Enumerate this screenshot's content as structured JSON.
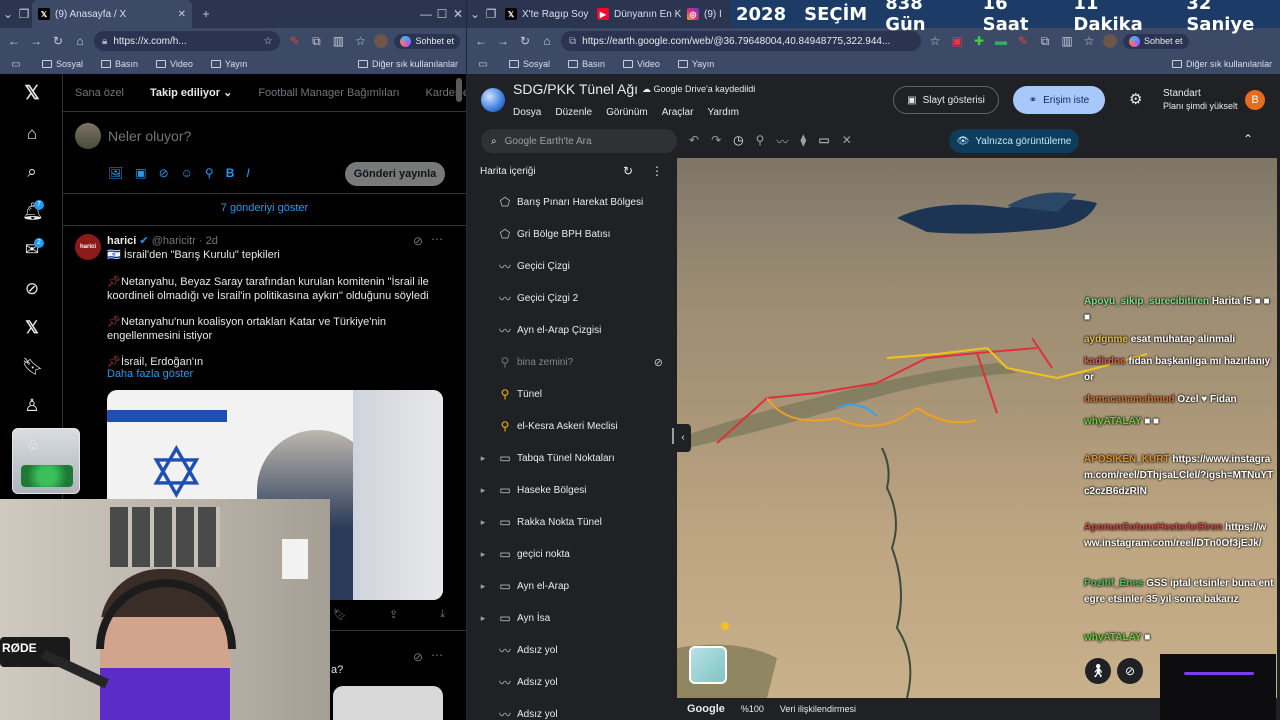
{
  "banner": {
    "year": "2028",
    "label": "SEÇİM",
    "days": "838 Gün",
    "hours": "16 Saat",
    "minutes": "11 Dakika",
    "seconds": "32 Saniye"
  },
  "left_browser": {
    "tab_title": "(9) Anasayfa / X",
    "url": "https://x.com/h...",
    "copilot_label": "Sohbet et",
    "bookmarks": [
      "Sosyal",
      "Basın",
      "Video",
      "Yayın"
    ],
    "other_bookmarks": "Diğer sık kullanılanlar"
  },
  "x": {
    "tabs": {
      "for_you": "Sana özel",
      "following": "Takip ediliyor",
      "fm": "Football Manager Bağımlıları",
      "kardesler": "Kardeşler Kr"
    },
    "composer_placeholder": "Neler oluyor?",
    "post_button": "Gönderi yayınla",
    "show_posts": "7 gönderiyi göster",
    "badges": {
      "notifications": "7",
      "messages": "2"
    },
    "post": {
      "author": "harici",
      "handle": "@haricitr · 2d",
      "avatar_text": "harici",
      "line1": "İsrail'den \"Barış Kurulu\" tepkileri",
      "p1": "Netanyahu, Beyaz Saray tarafından kurulan komitenin \"İsrail ile koordineli olmadığı ve İsrail'in politikasına aykırı\" olduğunu söyledi",
      "p2": "Netanyahu'nun koalisyon ortakları Katar ve Türkiye'nin engellenmesini istiyor",
      "p3": "İsrail, Erdoğan'ın",
      "show_more": "Daha fazla göster"
    },
    "next_post_snippet": "a?"
  },
  "right_browser": {
    "tabs": [
      "X'te Ragıp Soy",
      "Dünyanın En K",
      "(9) I"
    ],
    "url": "https://earth.google.com/web/@36.79648004,40.84948775,322.944...",
    "copilot_label": "Sohbet et",
    "bookmarks": [
      "Sosyal",
      "Basın",
      "Video",
      "Yayın"
    ],
    "other_bookmarks": "Diğer sık kullanılanlar"
  },
  "earth": {
    "project_title": "SDG/PKK Tünel Ağı",
    "saved_status": "Google Drive'a kaydedildi",
    "menu": [
      "Dosya",
      "Düzenle",
      "Görünüm",
      "Araçlar",
      "Yardım"
    ],
    "slideshow": "Slayt gösterisi",
    "request_access": "Erişim iste",
    "plan_name": "Standart",
    "plan_upgrade": "Planı şimdi yükselt",
    "avatar_letter": "B",
    "search_placeholder": "Google Earth'te Ara",
    "view_only": "Yalnızca görüntüleme",
    "panel_title": "Harita içeriği",
    "items": [
      {
        "label": "Barış Pınarı Harekat Bölgesi",
        "icon": "polygon-icon",
        "glyph": "⬠",
        "folder": false
      },
      {
        "label": "Gri Bölge BPH Batısı",
        "icon": "polygon-icon",
        "glyph": "⬠",
        "folder": false
      },
      {
        "label": "Geçici Çizgi",
        "icon": "path-icon",
        "glyph": "〰",
        "folder": false
      },
      {
        "label": "Geçici Çizgi 2",
        "icon": "path-icon",
        "glyph": "〰",
        "folder": false
      },
      {
        "label": "Ayn el-Arap Çizgisi",
        "icon": "path-icon",
        "glyph": "〰",
        "folder": false
      },
      {
        "label": "bina zemini?",
        "icon": "pin-icon",
        "glyph": "⚲",
        "folder": false,
        "dim": true
      },
      {
        "label": "Tünel",
        "icon": "pin-icon",
        "glyph": "⚲",
        "folder": false,
        "orange": true
      },
      {
        "label": "el-Kesra Askeri Meclisi",
        "icon": "pin-icon",
        "glyph": "⚲",
        "folder": false,
        "orange": true
      },
      {
        "label": "Tabqa Tünel Noktaları",
        "icon": "folder-icon",
        "glyph": "▭",
        "folder": true
      },
      {
        "label": "Haseke Bölgesi",
        "icon": "folder-icon",
        "glyph": "▭",
        "folder": true
      },
      {
        "label": "Rakka Nokta Tünel",
        "icon": "folder-icon",
        "glyph": "▭",
        "folder": true
      },
      {
        "label": "geçici nokta",
        "icon": "folder-icon",
        "glyph": "▭",
        "folder": true
      },
      {
        "label": "Ayn el-Arap",
        "icon": "folder-icon",
        "glyph": "▭",
        "folder": true
      },
      {
        "label": "Ayn İsa",
        "icon": "folder-icon",
        "glyph": "▭",
        "folder": true
      },
      {
        "label": "Adsız yol",
        "icon": "path-icon",
        "glyph": "〰",
        "folder": false
      },
      {
        "label": "Adsız yol",
        "icon": "path-icon",
        "glyph": "〰",
        "folder": false
      },
      {
        "label": "Adsız yol",
        "icon": "path-icon",
        "glyph": "〰",
        "folder": false
      }
    ],
    "footer": {
      "google": "Google",
      "zoom": "%100",
      "attribution": "Veri ilişkilendirmesi"
    }
  },
  "chat": [
    {
      "user": "Apoyu_sikip_surecibitiren",
      "text": "Harita f5 ■ ■ ■",
      "color": "#7ee08a"
    },
    {
      "user": "aydgnme",
      "text": "esat muhatap alinmali",
      "color": "#e6c23a"
    },
    {
      "user": "kadirdnc",
      "text": "fidan başkanlıga mı hazırlanıyor",
      "color": "#e05a5a"
    },
    {
      "user": "damacanamahmud",
      "text": "Ozel ♥ Fidan",
      "color": "#d8703a"
    },
    {
      "user": "whyATALAY",
      "text": "■ ■",
      "color": "#6ccf3a"
    },
    {
      "user": "APOSIKEN_KURT",
      "text": "https://www.instagram.com/reel/DThjsaLClel/?igsh=MTNuYTc2czB6dzRlN",
      "color": "#e0922a"
    },
    {
      "user": "AponunGotuneHesterieGiren",
      "text": "https://www.instagram.com/reel/DTn0Of3jEJk/",
      "color": "#d04848"
    },
    {
      "user": "Pozitif_Enes",
      "text": "GSS iptal etsinler buna entegre etsinler 35 yıl sonra bakarız",
      "color": "#50c060"
    },
    {
      "user": "whyATALAY",
      "text": "■",
      "color": "#6ccf3a"
    }
  ],
  "webcam": {
    "mic_brand": "RØDE"
  }
}
